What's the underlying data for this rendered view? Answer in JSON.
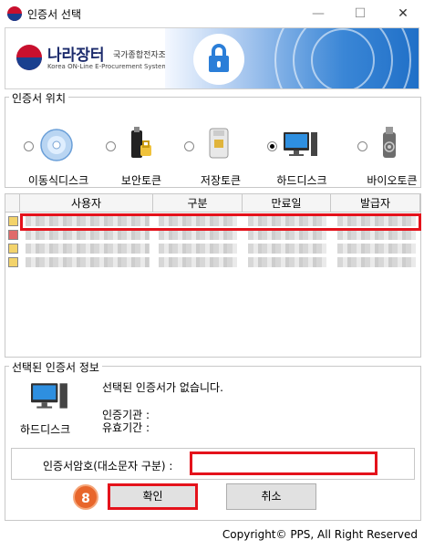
{
  "window": {
    "title": "인증서 선택",
    "minimize": "—",
    "maximize": "☐",
    "close": "✕"
  },
  "banner": {
    "logo_main": "나라장터",
    "logo_sub": "국가종합전자조달",
    "logo_en": "Korea ON-Line E-Procurement System",
    "accent_color": "#2b7ed8"
  },
  "location": {
    "group_title": "인증서 위치",
    "items": [
      {
        "label": "이동식디스크",
        "icon": "cd-disk-icon",
        "selected": false
      },
      {
        "label": "보안토큰",
        "icon": "security-token-icon",
        "selected": false
      },
      {
        "label": "저장토큰",
        "icon": "storage-token-icon",
        "selected": false
      },
      {
        "label": "하드디스크",
        "icon": "computer-icon",
        "selected": true
      },
      {
        "label": "바이오토큰",
        "icon": "bio-token-icon",
        "selected": false
      }
    ]
  },
  "cert_list": {
    "columns": [
      "사용자",
      "구분",
      "만료일",
      "발급자"
    ],
    "rows": 4,
    "highlight_color": "#e4121b"
  },
  "selected_info": {
    "group_title": "선택된 인증서 정보",
    "device_label": "하드디스크",
    "empty_message": "선택된 인증서가 없습니다.",
    "issuer_label": "인증기관 :",
    "validity_label": "유효기간 :"
  },
  "password": {
    "label": "인증서암호(대소문자 구분) :",
    "value": ""
  },
  "buttons": {
    "confirm": "확인",
    "cancel": "취소",
    "step_number": "8"
  },
  "footer": {
    "copyright": "Copyright© PPS, All Right Reserved"
  }
}
